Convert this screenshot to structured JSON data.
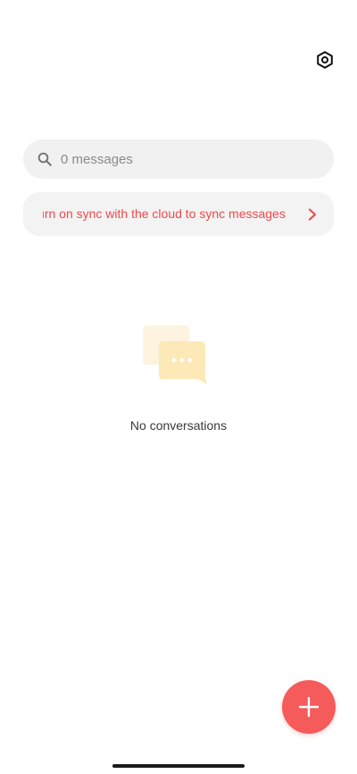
{
  "header": {
    "settings_icon": "settings-icon"
  },
  "search": {
    "placeholder": "0 messages",
    "icon": "search-icon"
  },
  "sync_banner": {
    "text": "Turn on sync with the cloud to sync messages",
    "color": "#ee4a4a",
    "icon": "chevron-right-icon"
  },
  "empty_state": {
    "icon": "chat-bubbles-icon",
    "label": "No conversations"
  },
  "fab": {
    "icon": "plus-icon",
    "color": "#f55b5b"
  }
}
